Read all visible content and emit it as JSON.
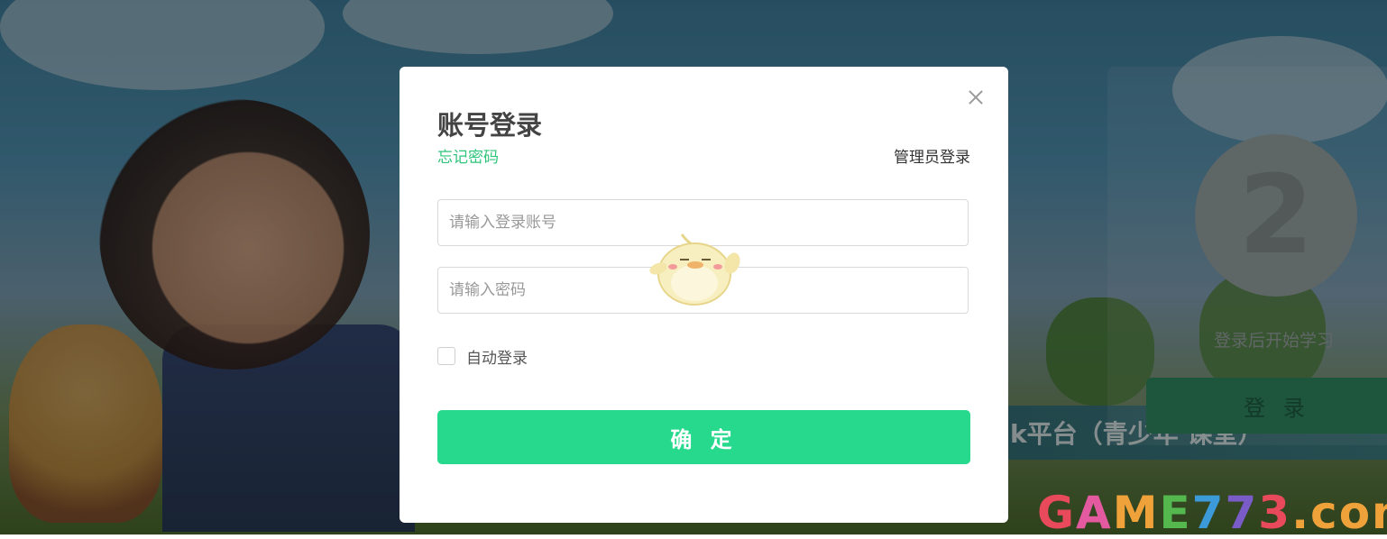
{
  "modal": {
    "title": "账号登录",
    "forgot_password": "忘记密码",
    "admin_login": "管理员登录",
    "account_placeholder": "请输入登录账号",
    "password_placeholder": "请输入密码",
    "auto_login_label": "自动登录",
    "auto_login_checked": false,
    "submit_label": "确 定",
    "close_icon": "close-icon"
  },
  "background_panel": {
    "avatar_digit": "2",
    "hint": "登录后开始学习",
    "login_button": "登 录",
    "sign_text": "k平台（青少年 课堂）"
  },
  "watermark": {
    "letters": [
      "G",
      "A",
      "M",
      "E",
      "7",
      "7",
      "3",
      ".com"
    ]
  },
  "colors": {
    "accent": "#26d98c",
    "link_green": "#2fc57a",
    "overlay": "rgba(0,0,0,0.38)"
  }
}
